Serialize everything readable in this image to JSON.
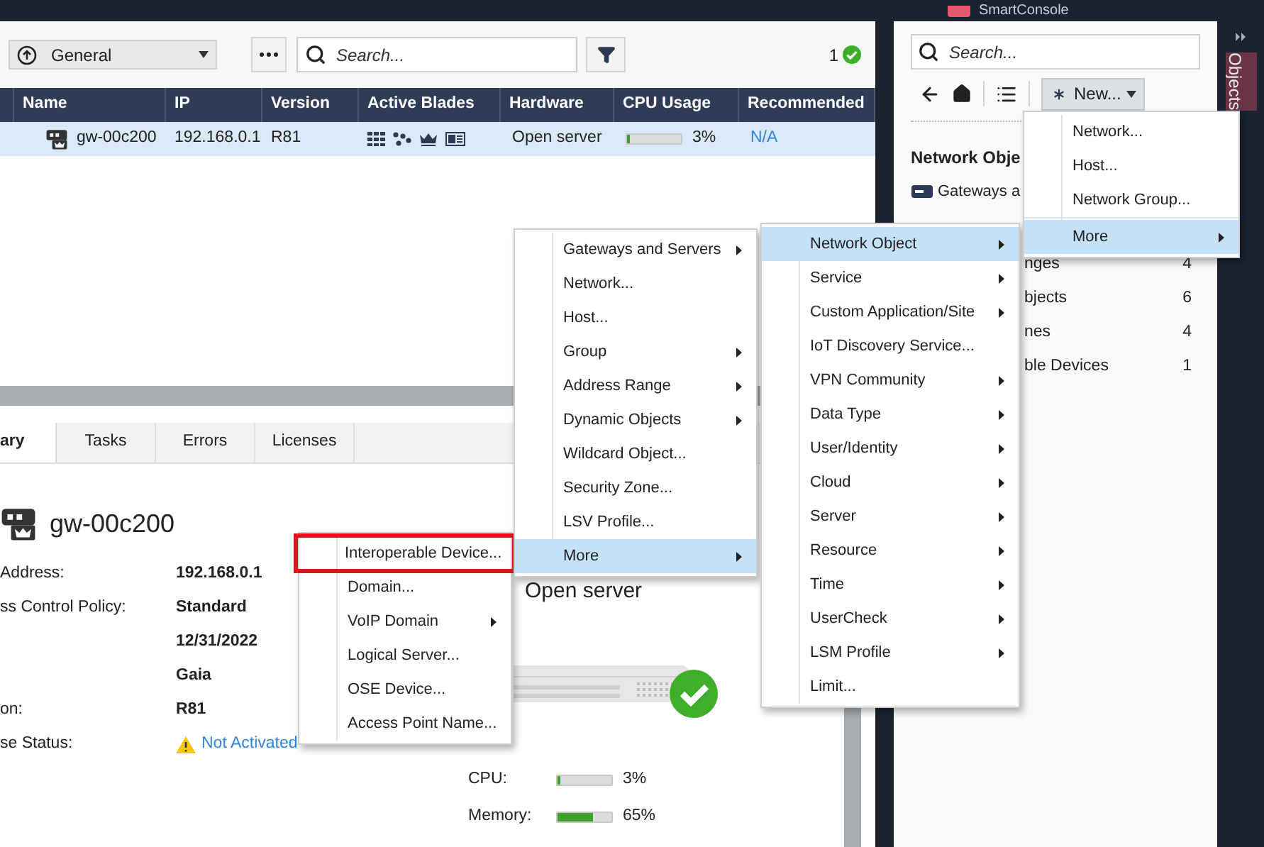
{
  "top_bar": {
    "title": "SmartConsole"
  },
  "toolbar": {
    "view_dropdown": {
      "value": "General"
    },
    "search": {
      "placeholder": "Search..."
    },
    "status_count": "1"
  },
  "table": {
    "columns": [
      "Name",
      "IP",
      "Version",
      "Active Blades",
      "Hardware",
      "CPU Usage",
      "Recommended"
    ],
    "rows": [
      {
        "name": "gw-00c200",
        "ip": "192.168.0.1",
        "version": "R81",
        "hardware": "Open server",
        "cpu": {
          "level": 0.03,
          "reading": "3%"
        },
        "recommended": "N/A",
        "selected": true
      }
    ]
  },
  "details": {
    "tabs": [
      {
        "label": "ary",
        "selected": true
      },
      {
        "label": "Tasks",
        "selected": false
      },
      {
        "label": "Errors",
        "selected": false
      },
      {
        "label": "Licenses",
        "selected": false
      }
    ],
    "title": "gw-00c200",
    "fields": [
      {
        "label": "Address:",
        "value": "192.168.0.1",
        "kind": "text"
      },
      {
        "label": "ss Control Policy:",
        "value": "Standard",
        "kind": "text"
      },
      {
        "value": "12/31/2022",
        "kind": "text"
      },
      {
        "value": "Gaia",
        "kind": "text"
      },
      {
        "label": "on:",
        "value": "R81",
        "kind": "text"
      },
      {
        "label": "se Status:",
        "value": "Not Activated",
        "kind": "warning"
      }
    ],
    "hardware": "Open server",
    "meters": [
      {
        "label": "CPU:",
        "level": 0.03,
        "reading": "3%"
      },
      {
        "label": "Memory:",
        "level": 0.65,
        "reading": "65%"
      }
    ]
  },
  "object_panel": {
    "search": {
      "placeholder": "Search..."
    },
    "new_button": "New...",
    "heading": "Network Obje",
    "items": [
      {
        "label": "Gateways a"
      },
      {
        "label": "nges",
        "count": "4"
      },
      {
        "label": "bjects",
        "count": "6"
      },
      {
        "label": "nes",
        "count": "4"
      },
      {
        "label": "ble Devices",
        "count": "1"
      }
    ]
  },
  "side_tab": {
    "label": "Objects"
  },
  "menus": [
    {
      "sections": [
        [
          {
            "label": "Interoperable Device...",
            "submenu": false,
            "selected": false,
            "highlighted": true
          },
          {
            "label": "Domain...",
            "submenu": false,
            "selected": false,
            "highlighted": false
          },
          {
            "label": "VoIP Domain",
            "submenu": true,
            "selected": false,
            "highlighted": false
          },
          {
            "label": "Logical Server...",
            "submenu": false,
            "selected": false,
            "highlighted": false
          },
          {
            "label": "OSE Device...",
            "submenu": false,
            "selected": false,
            "highlighted": false
          },
          {
            "label": "Access Point Name...",
            "submenu": false,
            "selected": false,
            "highlighted": false
          }
        ]
      ]
    },
    {
      "sections": [
        [
          {
            "label": "Gateways and Servers",
            "submenu": true,
            "selected": false
          },
          {
            "label": "Network...",
            "submenu": false,
            "selected": false
          },
          {
            "label": "Host...",
            "submenu": false,
            "selected": false
          },
          {
            "label": "Group",
            "submenu": true,
            "selected": false
          },
          {
            "label": "Address Range",
            "submenu": true,
            "selected": false
          },
          {
            "label": "Dynamic Objects",
            "submenu": true,
            "selected": false
          },
          {
            "label": "Wildcard Object...",
            "submenu": false,
            "selected": false
          },
          {
            "label": "Security Zone...",
            "submenu": false,
            "selected": false
          },
          {
            "label": "LSV Profile...",
            "submenu": false,
            "selected": false
          },
          {
            "label": "More",
            "submenu": true,
            "selected": true
          }
        ]
      ]
    },
    {
      "sections": [
        [
          {
            "label": "Network Object",
            "submenu": true,
            "selected": true
          },
          {
            "label": "Service",
            "submenu": true,
            "selected": false
          },
          {
            "label": "Custom Application/Site",
            "submenu": true,
            "selected": false
          },
          {
            "label": "IoT Discovery Service...",
            "submenu": false,
            "selected": false
          },
          {
            "label": "VPN Community",
            "submenu": true,
            "selected": false
          },
          {
            "label": "Data Type",
            "submenu": true,
            "selected": false
          },
          {
            "label": "User/Identity",
            "submenu": true,
            "selected": false
          },
          {
            "label": "Cloud",
            "submenu": true,
            "selected": false
          },
          {
            "label": "Server",
            "submenu": true,
            "selected": false
          },
          {
            "label": "Resource",
            "submenu": true,
            "selected": false
          },
          {
            "label": "Time",
            "submenu": true,
            "selected": false
          },
          {
            "label": "UserCheck",
            "submenu": true,
            "selected": false
          },
          {
            "label": "LSM Profile",
            "submenu": true,
            "selected": false
          },
          {
            "label": "Limit...",
            "submenu": false,
            "selected": false
          }
        ]
      ]
    },
    {
      "sections": [
        [
          {
            "label": "Network...",
            "submenu": false,
            "selected": false
          },
          {
            "label": "Host...",
            "submenu": false,
            "selected": false
          },
          {
            "label": "Network Group...",
            "submenu": false,
            "selected": false
          }
        ],
        [
          {
            "label": "More",
            "submenu": true,
            "selected": true
          }
        ]
      ]
    }
  ]
}
